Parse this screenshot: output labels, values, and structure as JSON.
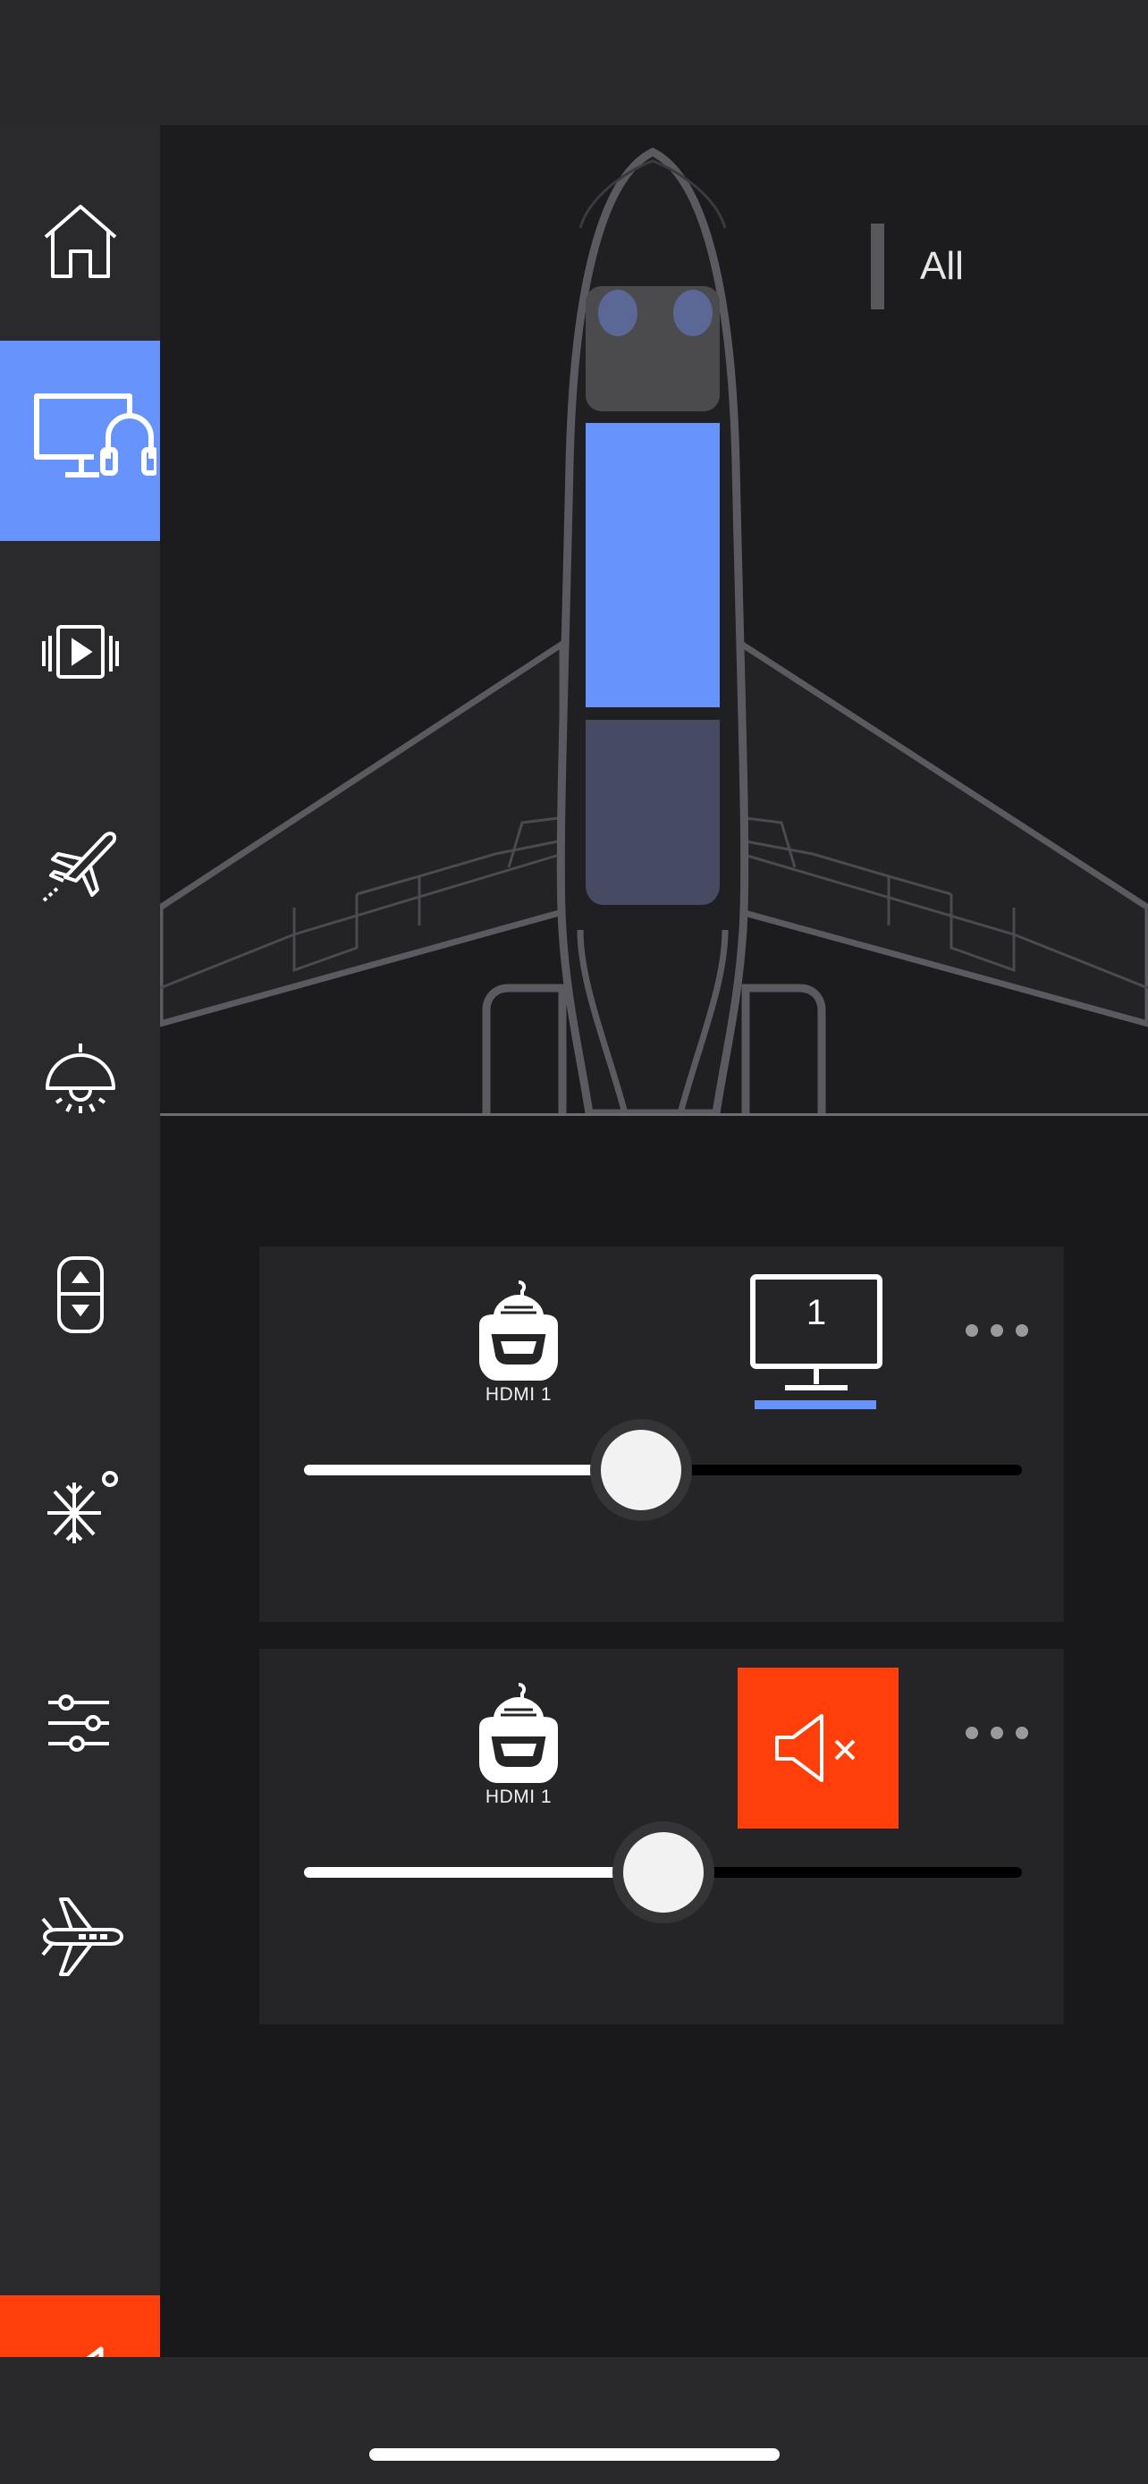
{
  "zone_selector": {
    "label": "All"
  },
  "sidebar": {
    "items": [
      {
        "icon": "home-icon",
        "active": false
      },
      {
        "icon": "monitor-headphones-icon",
        "active": true
      },
      {
        "icon": "video-playback-icon",
        "active": false
      },
      {
        "icon": "airplane-takeoff-icon",
        "active": false
      },
      {
        "icon": "ceiling-light-icon",
        "active": false
      },
      {
        "icon": "window-shade-icon",
        "active": false
      },
      {
        "icon": "climate-snowflake-icon",
        "active": false
      },
      {
        "icon": "settings-sliders-icon",
        "active": false
      },
      {
        "icon": "airplane-icon",
        "active": false
      }
    ],
    "mute_all": {
      "icon": "speaker-mute-icon"
    }
  },
  "plane": {
    "zones": [
      {
        "name": "front",
        "active": false
      },
      {
        "name": "middle",
        "active": true
      },
      {
        "name": "rear",
        "active": false
      }
    ]
  },
  "cards": [
    {
      "source": {
        "label": "HDMI 1",
        "icon": "hdmi-connector-icon"
      },
      "display": {
        "label": "1",
        "icon": "monitor-icon",
        "selected": true
      },
      "more": {
        "icon": "more-dots-icon"
      },
      "volume": 0.47
    },
    {
      "source": {
        "label": "HDMI 1",
        "icon": "hdmi-connector-icon"
      },
      "mute": {
        "icon": "speaker-mute-icon",
        "active": true
      },
      "more": {
        "icon": "more-dots-icon"
      },
      "volume": 0.5
    }
  ],
  "colors": {
    "accent": "#6694fc",
    "mute": "#ff3e09",
    "background": "#19191b",
    "sidebar": "#2a2a2d",
    "card": "#252527"
  }
}
